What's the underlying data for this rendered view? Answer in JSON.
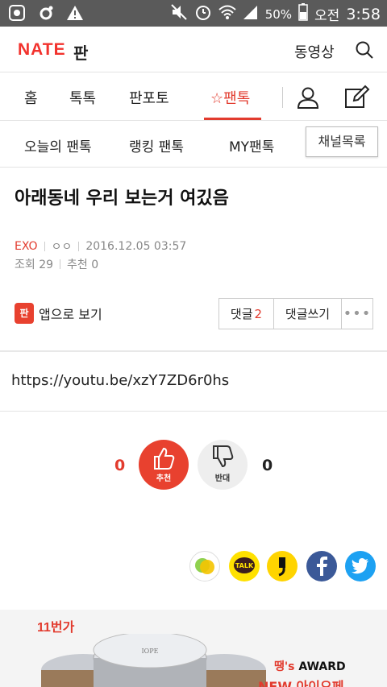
{
  "statusbar": {
    "battery": "50%",
    "ampm": "오전",
    "time": "3:58"
  },
  "header": {
    "logo": "NATE",
    "logo_sub": "판",
    "video_link": "동영상"
  },
  "mainnav": {
    "tabs": [
      {
        "label": "홈"
      },
      {
        "label": "톡톡"
      },
      {
        "label": "판포토"
      },
      {
        "label": "팬톡",
        "active": true
      }
    ]
  },
  "subnav": {
    "tabs": [
      {
        "label": "오늘의 팬톡"
      },
      {
        "label": "랭킹 팬톡"
      },
      {
        "label": "MY팬톡"
      }
    ],
    "channel_list": "채널목록"
  },
  "article": {
    "title": "아래동네 우리 보는거 여깄음",
    "channel": "EXO",
    "author": "ㅇㅇ",
    "datetime": "2016.12.05 03:57",
    "views": "조회 29",
    "recommend": "추천 0",
    "app_view": "앱으로 보기",
    "app_icon_text": "판",
    "comment_label": "댓글",
    "comment_count": "2",
    "write_comment": "댓글쓰기",
    "link": "https://youtu.be/xzY7ZD6r0hs"
  },
  "votes": {
    "up_count": "0",
    "up_label": "추천",
    "down_label": "반대",
    "down_count": "0"
  },
  "share": {
    "kakaotalk_text": "TALK"
  },
  "ad": {
    "brand_11": "11번가",
    "award_prefix": "땡's",
    "award": "AWARD",
    "new_text": "NEW 아이오페"
  },
  "colors": {
    "accent": "#e23b2e",
    "statusbar": "#5a5a5a"
  }
}
